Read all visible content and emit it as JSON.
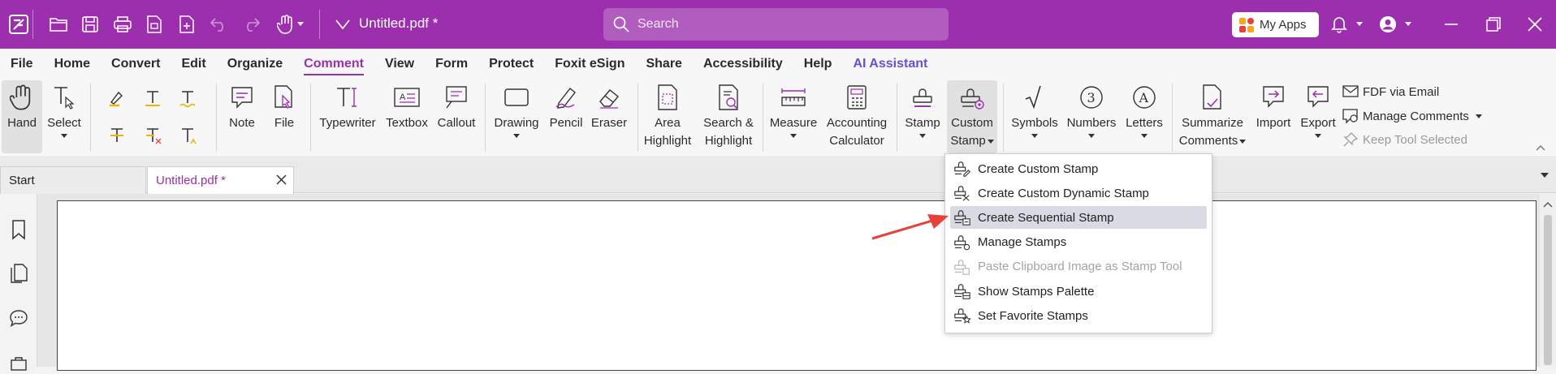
{
  "titlebar": {
    "doc_title": "Untitled.pdf *",
    "search_placeholder": "Search",
    "my_apps_label": "My Apps",
    "colors": {
      "brand": "#9b2fae"
    }
  },
  "menu": {
    "tabs": [
      "File",
      "Home",
      "Convert",
      "Edit",
      "Organize",
      "Comment",
      "View",
      "Form",
      "Protect",
      "Foxit eSign",
      "Share",
      "Accessibility",
      "Help",
      "AI Assistant"
    ],
    "active": "Comment"
  },
  "ribbon": {
    "hand": "Hand",
    "select": "Select",
    "note": "Note",
    "file": "File",
    "typewriter": "Typewriter",
    "textbox": "Textbox",
    "callout": "Callout",
    "drawing": "Drawing",
    "pencil": "Pencil",
    "eraser": "Eraser",
    "area_highlight_1": "Area",
    "area_highlight_2": "Highlight",
    "search_highlight_1": "Search &",
    "search_highlight_2": "Highlight",
    "measure": "Measure",
    "accounting_1": "Accounting",
    "accounting_2": "Calculator",
    "stamp": "Stamp",
    "custom_stamp_1": "Custom",
    "custom_stamp_2": "Stamp",
    "symbols": "Symbols",
    "numbers": "Numbers",
    "letters": "Letters",
    "summarize_1": "Summarize",
    "summarize_2": "Comments",
    "import": "Import",
    "export": "Export",
    "fdf_email": "FDF via Email",
    "manage_comments": "Manage Comments",
    "keep_tool": "Keep Tool Selected"
  },
  "doc_tabs": {
    "start": "Start",
    "active": "Untitled.pdf *"
  },
  "custom_stamp_menu": [
    {
      "label": "Create Custom Stamp",
      "icon": "create-stamp-icon"
    },
    {
      "label": "Create Custom Dynamic Stamp",
      "icon": "dynamic-stamp-icon"
    },
    {
      "label": "Create Sequential Stamp",
      "icon": "sequential-stamp-icon"
    },
    {
      "label": "Manage Stamps",
      "icon": "manage-stamps-icon"
    },
    {
      "label": "Paste Clipboard Image as Stamp Tool",
      "icon": "paste-stamp-icon"
    },
    {
      "label": "Show Stamps Palette",
      "icon": "stamps-palette-icon"
    },
    {
      "label": "Set Favorite Stamps",
      "icon": "favorite-stamps-icon"
    }
  ],
  "annotation_color": "#e8413a"
}
